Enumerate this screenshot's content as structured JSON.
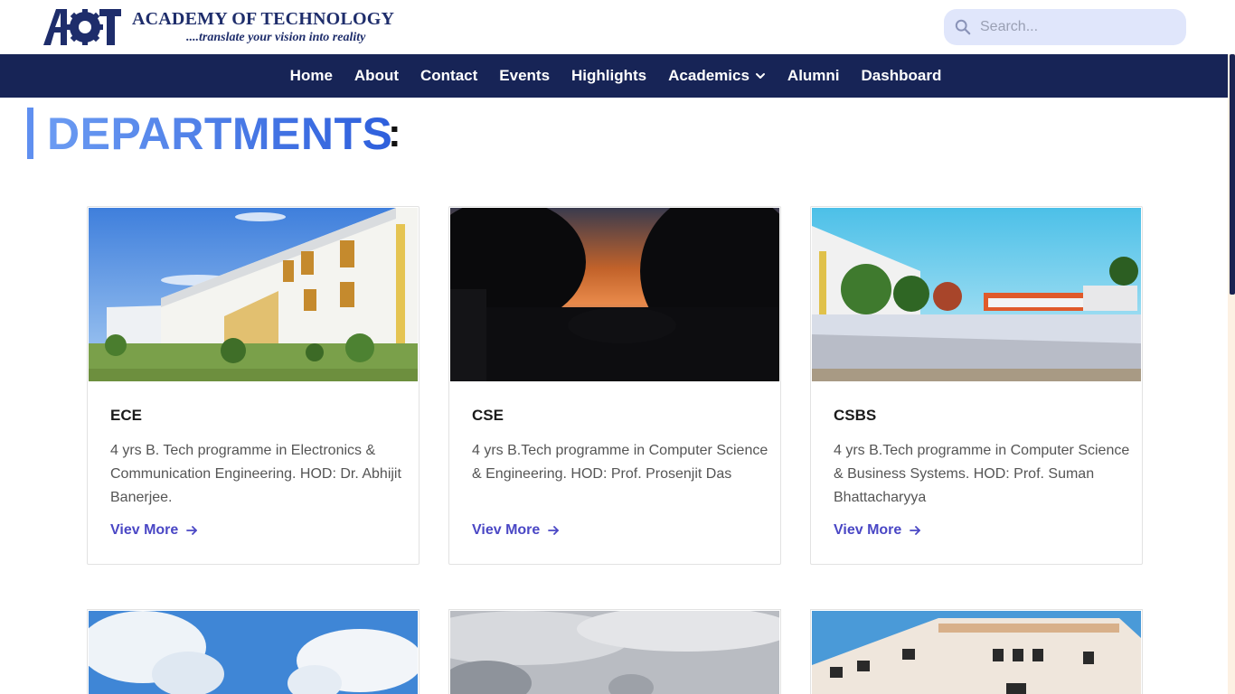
{
  "brand": {
    "name": "ACADEMY OF TECHNOLOGY",
    "tagline": "....translate your vision into reality"
  },
  "search": {
    "placeholder": "Search..."
  },
  "nav": {
    "items": [
      {
        "label": "Home"
      },
      {
        "label": "About"
      },
      {
        "label": "Contact"
      },
      {
        "label": "Events"
      },
      {
        "label": "Highlights"
      },
      {
        "label": "Academics",
        "dropdown": true
      },
      {
        "label": "Alumni"
      },
      {
        "label": "Dashboard"
      }
    ]
  },
  "section": {
    "title": "DEPARTMENTS",
    "colon": ":"
  },
  "departments": [
    {
      "name": "ECE",
      "description": "4 yrs B. Tech programme in Electronics & Communication Engineering. HOD: Dr. Abhijit Banerjee.",
      "link": "Viev More"
    },
    {
      "name": "CSE",
      "description": "4 yrs B.Tech programme in Computer Science & Engineering. HOD: Prof. Prosenjit Das",
      "link": "Viev More"
    },
    {
      "name": "CSBS",
      "description": "4 yrs B.Tech programme in Computer Science & Business Systems. HOD: Prof. Suman Bhattacharyya",
      "link": "Viev More"
    }
  ],
  "colors": {
    "navbar": "#172456",
    "brand": "#1e2d6b",
    "link": "#4a47c5",
    "heading_start": "#6b9bf2",
    "heading_end": "#2e5fdc"
  }
}
